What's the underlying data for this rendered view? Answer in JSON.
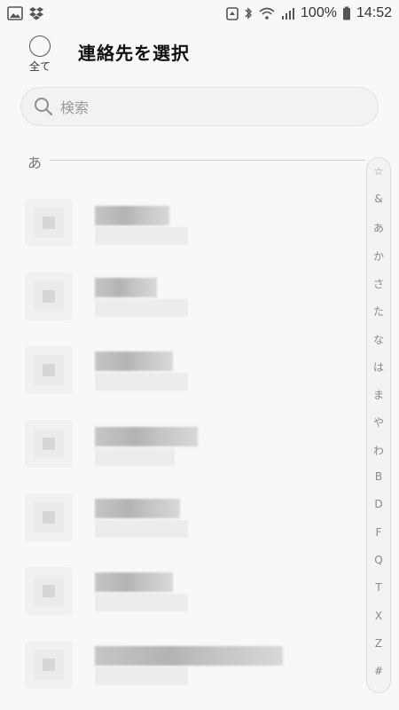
{
  "status_bar": {
    "left_icons": [
      "gallery-icon",
      "dropbox-icon"
    ],
    "right_icons": [
      "battery-saver-icon",
      "bluetooth-icon",
      "wifi-icon",
      "signal-icon"
    ],
    "battery_percent": "100%",
    "time": "14:52"
  },
  "header": {
    "select_all_label": "全て",
    "title": "連絡先を選択"
  },
  "search": {
    "icon": "search-icon",
    "placeholder": "検索"
  },
  "section": {
    "letter": "あ"
  },
  "contacts": [
    {
      "name_blurred": true
    },
    {
      "name_blurred": true
    },
    {
      "name_blurred": true
    },
    {
      "name_blurred": true
    },
    {
      "name_blurred": true
    },
    {
      "name_blurred": true
    },
    {
      "name_blurred": true
    }
  ],
  "index": [
    "☆",
    "&",
    "あ",
    "か",
    "さ",
    "た",
    "な",
    "は",
    "ま",
    "や",
    "わ",
    "B",
    "D",
    "F",
    "Q",
    "T",
    "X",
    "Z",
    "#"
  ]
}
